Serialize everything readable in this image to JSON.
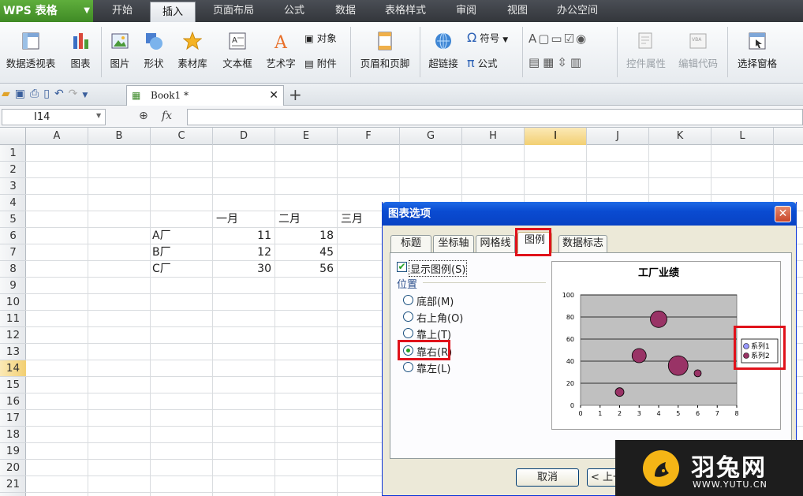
{
  "app": {
    "logo": "WPS 表格"
  },
  "menu": {
    "tabs": [
      "开始",
      "插入",
      "页面布局",
      "公式",
      "数据",
      "表格样式",
      "审阅",
      "视图",
      "办公空间"
    ],
    "active": "插入"
  },
  "ribbon": {
    "pivot": "数据透视表",
    "chart": "图表",
    "picture": "图片",
    "shapes": "形状",
    "clipart": "素材库",
    "textbox": "文本框",
    "wordart": "艺术字",
    "object": "对象",
    "attachment": "附件",
    "header_footer": "页眉和页脚",
    "hyperlink": "超链接",
    "symbol": "符号",
    "formula": "公式",
    "control_props": "控件属性",
    "edit_code": "编辑代码",
    "select_pane": "选择窗格"
  },
  "doc_tab": {
    "name": "Book1 *"
  },
  "formula_bar": {
    "name_box": "I14",
    "fx": "fx"
  },
  "sheet": {
    "columns": [
      "A",
      "B",
      "C",
      "D",
      "E",
      "F",
      "G",
      "H",
      "I",
      "J",
      "K",
      "L"
    ],
    "selected_column": "I",
    "rows": [
      "1",
      "2",
      "3",
      "4",
      "5",
      "6",
      "7",
      "8",
      "9",
      "10",
      "11",
      "12",
      "13",
      "14",
      "15",
      "16",
      "17",
      "18",
      "19",
      "20",
      "21"
    ],
    "selected_row": "14",
    "header_row": {
      "d": "一月",
      "e": "二月",
      "f": "三月"
    },
    "data": [
      {
        "label": "A厂",
        "d": "11",
        "e": "18"
      },
      {
        "label": "B厂",
        "d": "12",
        "e": "45"
      },
      {
        "label": "C厂",
        "d": "30",
        "e": "56"
      }
    ]
  },
  "dialog": {
    "title": "图表选项",
    "close": "✕",
    "tabs": [
      "标题",
      "坐标轴",
      "网格线",
      "图例",
      "数据标志"
    ],
    "active_tab": "图例",
    "show_legend": "显示图例(S)",
    "position_label": "位置",
    "positions": [
      "底部(M)",
      "右上角(O)",
      "靠上(T)",
      "靠右(R)",
      "靠左(L)"
    ],
    "selected_position": "靠右(R)",
    "buttons": {
      "cancel": "取消",
      "back": "< 上一"
    }
  },
  "watermark": {
    "brand": "羽兔网",
    "url": "WWW.YUTU.CN"
  },
  "chart_data": {
    "type": "scatter",
    "title": "工厂业绩",
    "xlim": [
      0,
      8
    ],
    "ylim": [
      0,
      100
    ],
    "xticks": [
      0,
      1,
      2,
      3,
      4,
      5,
      6,
      7,
      8
    ],
    "yticks": [
      0,
      20,
      40,
      60,
      80,
      100
    ],
    "grid": true,
    "legend_position": "right",
    "series": [
      {
        "name": "系列1",
        "color": "#9999ff",
        "points": []
      },
      {
        "name": "系列2",
        "color": "#993366",
        "points": [
          {
            "x": 2,
            "y": 12,
            "size": 11
          },
          {
            "x": 3,
            "y": 45,
            "size": 18
          },
          {
            "x": 4,
            "y": 78,
            "size": 21
          },
          {
            "x": 5,
            "y": 36,
            "size": 25
          },
          {
            "x": 6,
            "y": 29,
            "size": 9
          }
        ]
      }
    ]
  }
}
